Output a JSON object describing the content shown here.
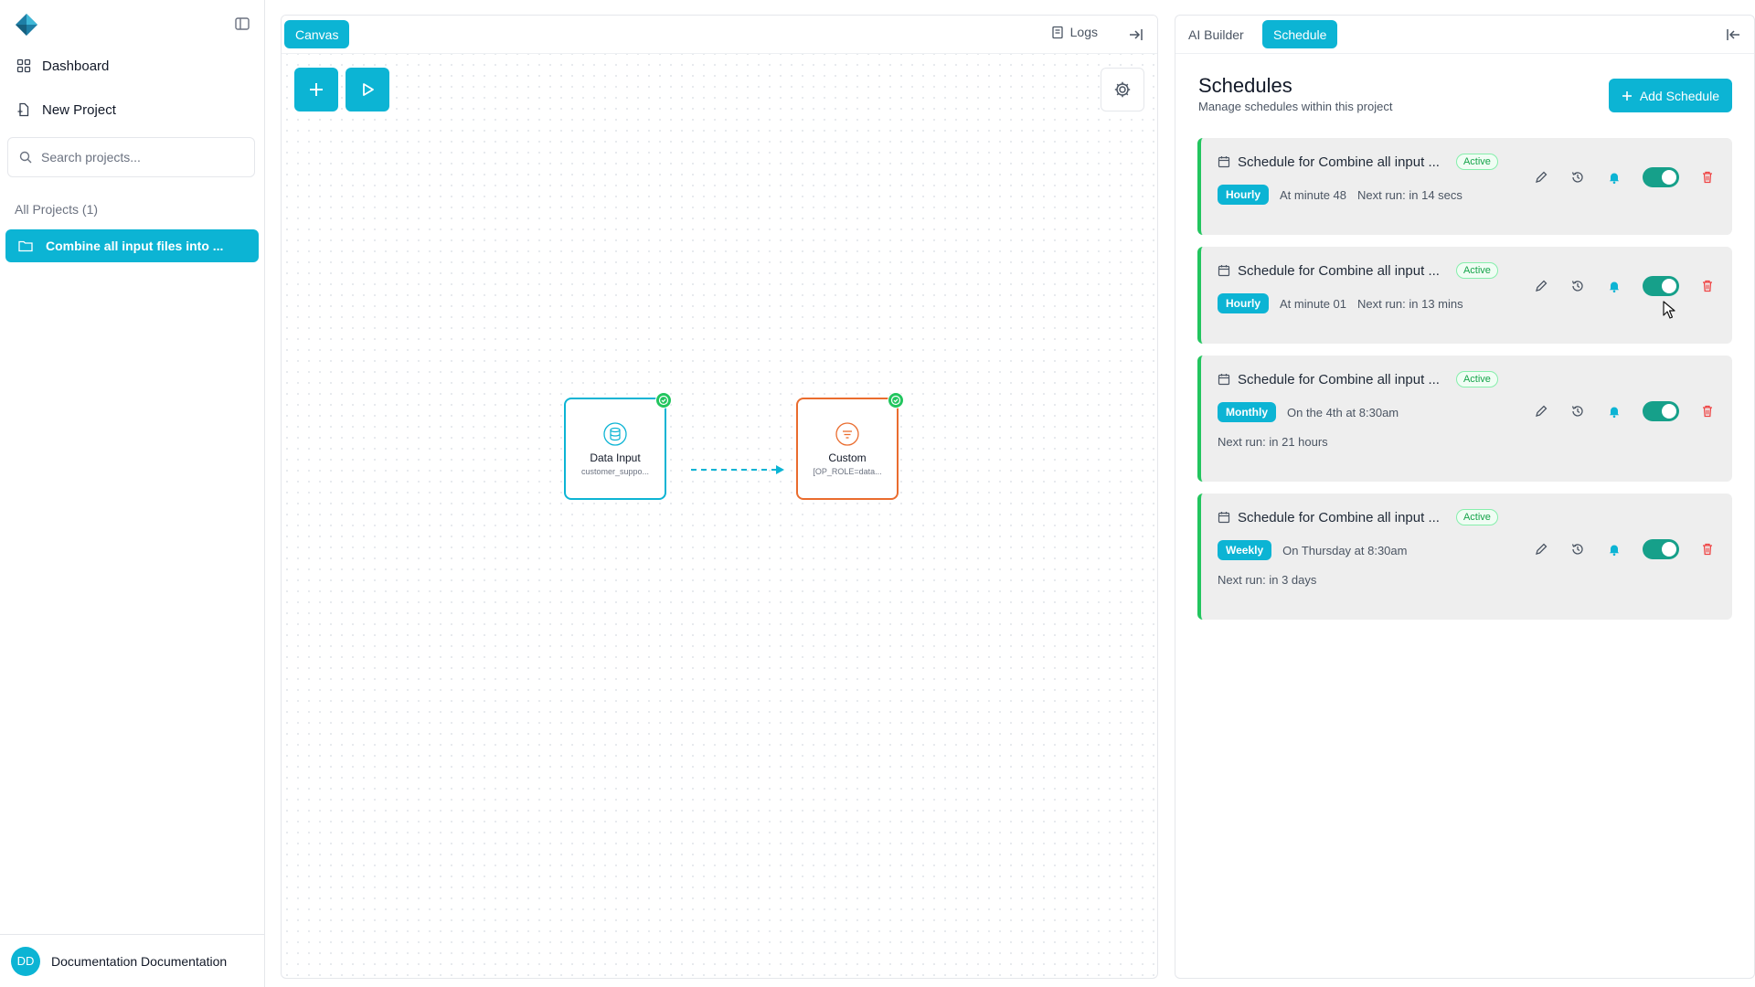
{
  "sidebar": {
    "nav": [
      {
        "label": "Dashboard",
        "icon": "dashboard-icon"
      },
      {
        "label": "New Project",
        "icon": "new-project-icon"
      }
    ],
    "search_placeholder": "Search projects...",
    "section_label": "All Projects (1)",
    "projects": [
      {
        "label": "Combine all input files into ...",
        "icon": "folder-icon"
      }
    ],
    "user": {
      "initials": "DD",
      "name": "Documentation Documentation"
    }
  },
  "canvas": {
    "tab_label": "Canvas",
    "logs_label": "Logs",
    "nodes": [
      {
        "title": "Data Input",
        "subtitle": "customer_suppo...",
        "color": "#0cb4d4",
        "status": "success"
      },
      {
        "title": "Custom",
        "subtitle": "[OP_ROLE=data...",
        "color": "#ea6c2e",
        "status": "success"
      }
    ]
  },
  "right_panel": {
    "tabs": [
      {
        "label": "AI Builder",
        "active": false
      },
      {
        "label": "Schedule",
        "active": true
      }
    ],
    "title": "Schedules",
    "subtitle": "Manage schedules within this project",
    "add_button": "Add Schedule",
    "schedules": [
      {
        "title": "Schedule for Combine all input ...",
        "status": "Active",
        "frequency": "Hourly",
        "detail": "At minute 48",
        "next_run": "Next run: in 14 secs",
        "enabled": true
      },
      {
        "title": "Schedule for Combine all input ...",
        "status": "Active",
        "frequency": "Hourly",
        "detail": "At minute 01",
        "next_run": "Next run: in 13 mins",
        "enabled": true
      },
      {
        "title": "Schedule for Combine all input ...",
        "status": "Active",
        "frequency": "Monthly",
        "detail": "On the 4th at 8:30am",
        "next_run": "Next run: in 21 hours",
        "enabled": true
      },
      {
        "title": "Schedule for Combine all input ...",
        "status": "Active",
        "frequency": "Weekly",
        "detail": "On Thursday at 8:30am",
        "next_run": "Next run: in 3 days",
        "enabled": true
      }
    ]
  },
  "colors": {
    "accent": "#0cb4d4",
    "success": "#22c55e",
    "toggle_on": "#16a08a",
    "danger": "#ef4444",
    "orange_node": "#ea6c2e"
  }
}
